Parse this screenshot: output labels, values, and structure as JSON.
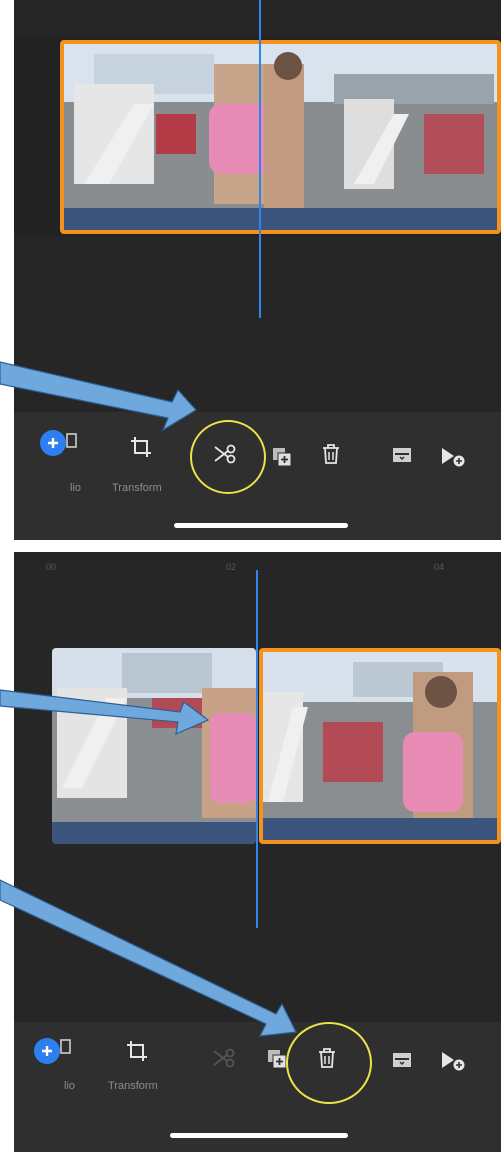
{
  "screenshot_top": {
    "toolbar": {
      "add_label": "lio",
      "transform_label": "Transform"
    },
    "tools": [
      "add-media",
      "transform",
      "split",
      "duplicate",
      "delete",
      "replace",
      "add-marker"
    ]
  },
  "screenshot_bottom": {
    "ruler": {
      "tick_00": "00",
      "tick_02": "02",
      "tick_04": "04"
    },
    "toolbar": {
      "add_label": "lio",
      "transform_label": "Transform"
    }
  },
  "colors": {
    "selected_clip_border": "#f5921e",
    "playhead": "#2f86e8",
    "highlight_circle": "#ece24a",
    "annotation_arrow": "#6fa8dc",
    "add_button": "#2d7ff0"
  }
}
